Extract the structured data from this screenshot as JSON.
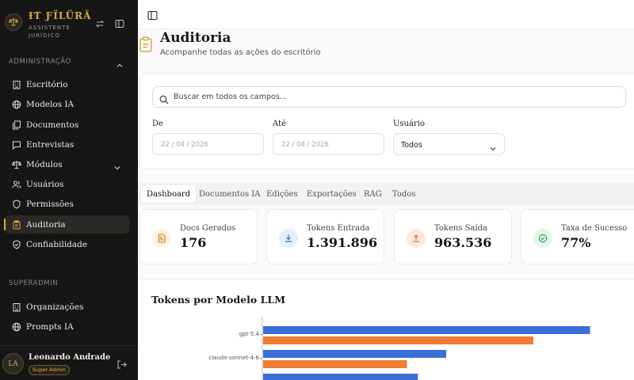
{
  "brand": {
    "name": "ƗƬ ƑÏLÜRÃ",
    "subtitle": "ASSISTENTE JURÍDICO"
  },
  "sidebar": {
    "sections": [
      {
        "title": "ADMINISTRAÇÃO"
      },
      {
        "title": "SUPERADMIN"
      }
    ],
    "admin_items": [
      {
        "label": "Escritório",
        "icon": "building-icon"
      },
      {
        "label": "Modelos IA",
        "icon": "globe-icon"
      },
      {
        "label": "Documentos",
        "icon": "documents-icon"
      },
      {
        "label": "Entrevistas",
        "icon": "chat-icon"
      },
      {
        "label": "Módulos",
        "icon": "scale-icon"
      },
      {
        "label": "Usuários",
        "icon": "users-icon"
      },
      {
        "label": "Permissões",
        "icon": "shield-icon"
      },
      {
        "label": "Auditoria",
        "icon": "clipboard-icon",
        "active": true
      },
      {
        "label": "Confiabilidade",
        "icon": "shield-check-icon"
      }
    ],
    "superadmin_items": [
      {
        "label": "Organizações",
        "icon": "building-icon"
      },
      {
        "label": "Prompts IA",
        "icon": "globe-icon"
      }
    ]
  },
  "user": {
    "initials": "LA",
    "name": "Leonardo Andrade",
    "role": "Super Admin"
  },
  "header": {
    "title": "Auditoria",
    "subtitle": "Acompanhe todas as ações do escritório"
  },
  "filters": {
    "search_placeholder": "Buscar em todos os campos...",
    "from_label": "De",
    "from_value": "22 / 04 / 2026",
    "to_label": "Até",
    "to_value": "22 / 04 / 2026",
    "user_label": "Usuário",
    "user_value": "Todos"
  },
  "tabs": [
    {
      "label": "Dashboard",
      "active": true
    },
    {
      "label": "Documentos IA"
    },
    {
      "label": "Edições"
    },
    {
      "label": "Exportações"
    },
    {
      "label": "RAG"
    },
    {
      "label": "Todos"
    }
  ],
  "kpis": [
    {
      "label": "Docs Gerados",
      "value": "176",
      "icon": "document-icon",
      "color": "#d97706",
      "bg": "#fdf1e2"
    },
    {
      "label": "Tokens Entrada",
      "value": "1.391.896",
      "icon": "download-icon",
      "color": "#2f6fd9",
      "bg": "#e6eefc"
    },
    {
      "label": "Tokens Saída",
      "value": "963.536",
      "icon": "upload-icon",
      "color": "#ea6a2a",
      "bg": "#fde8de"
    },
    {
      "label": "Taxa de Sucesso",
      "value": "77%",
      "icon": "check-circle-icon",
      "color": "#16a34a",
      "bg": "#e3f6ea"
    }
  ],
  "chart_title": "Tokens por Modelo LLM",
  "chart_data": {
    "type": "bar",
    "orientation": "horizontal",
    "categories": [
      "gpt-5.4",
      "claude-sonnet-4-6",
      ""
    ],
    "series": [
      {
        "values": [
          750000,
          420000,
          355000
        ],
        "color": "#3b6fd8"
      },
      {
        "values": [
          620000,
          330000,
          null
        ],
        "color": "#f07d32"
      }
    ],
    "xlim": [
      0,
      800000
    ]
  }
}
